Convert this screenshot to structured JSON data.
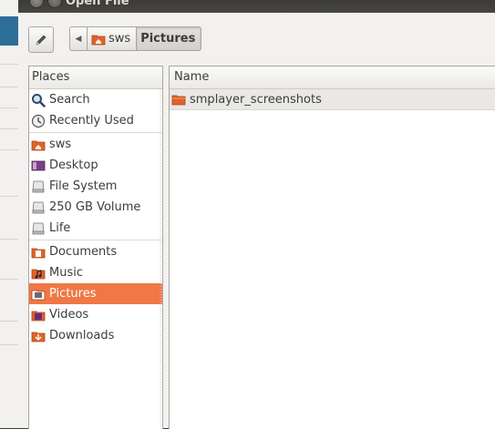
{
  "window": {
    "title": "Open File"
  },
  "pathbar": {
    "back_symbol": "◀",
    "crumbs": [
      {
        "label": "sws",
        "icon": "home-folder-icon"
      },
      {
        "label": "Pictures",
        "icon": "none"
      }
    ]
  },
  "places": {
    "header": "Places",
    "items": [
      {
        "label": "Search",
        "icon": "search-icon"
      },
      {
        "label": "Recently Used",
        "icon": "recent-icon"
      },
      {
        "label": "sws",
        "icon": "home-folder-icon"
      },
      {
        "label": "Desktop",
        "icon": "desktop-icon"
      },
      {
        "label": "File System",
        "icon": "drive-icon"
      },
      {
        "label": "250 GB Volume",
        "icon": "drive-icon"
      },
      {
        "label": "Life",
        "icon": "drive-icon"
      },
      {
        "label": "Documents",
        "icon": "documents-folder-icon"
      },
      {
        "label": "Music",
        "icon": "music-folder-icon"
      },
      {
        "label": "Pictures",
        "icon": "pictures-folder-icon",
        "selected": true
      },
      {
        "label": "Videos",
        "icon": "videos-folder-icon"
      },
      {
        "label": "Downloads",
        "icon": "downloads-folder-icon"
      }
    ]
  },
  "files": {
    "column_name": "Name",
    "rows": [
      {
        "name": "smplayer_screenshots",
        "icon": "folder-icon"
      }
    ]
  },
  "colors": {
    "selection": "#f07746",
    "folder": "#e0642a"
  }
}
